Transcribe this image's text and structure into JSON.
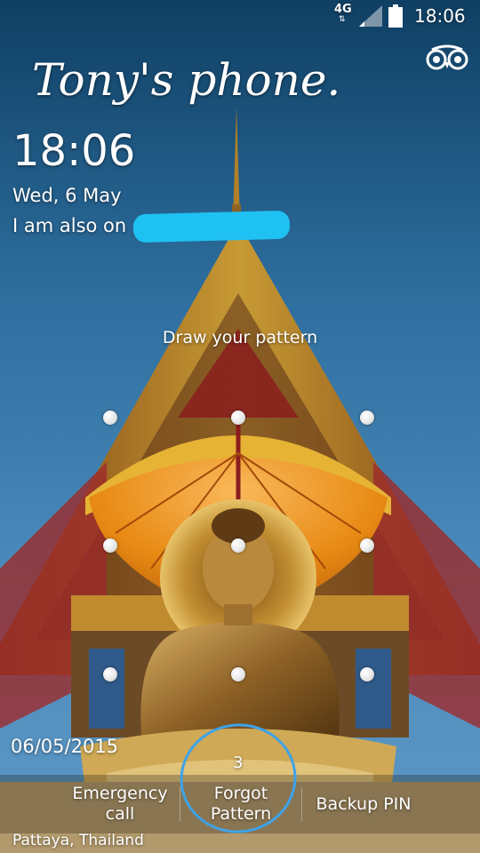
{
  "status_bar": {
    "network_type": "4G",
    "data_arrows": "⇅",
    "signal_icon": "signal-icon",
    "battery_icon": "battery-icon",
    "time": "18:06"
  },
  "app_icon": "tripadvisor-owl-icon",
  "lockscreen": {
    "owner_info": "Tony's phone.",
    "time": "18:06",
    "date": "Wed, 6 May",
    "status_message": "I am also on                      , thanks."
  },
  "pattern": {
    "instruction": "Draw your pattern",
    "dot_color": "#ffffff"
  },
  "wallpaper": {
    "date_stamp": "06/05/2015",
    "location": "Pattaya, Thailand"
  },
  "attempt_count": "3",
  "bottom_bar": {
    "emergency_call": "Emergency\ncall",
    "forgot_pattern": "Forgot\nPattern",
    "backup_pin": "Backup PIN"
  },
  "colors": {
    "sky": "#2f6ea3",
    "redaction": "#1ec1f2",
    "circle_highlight": "#3ea3ea",
    "umbrella": "#e88a14",
    "gold": "#c79a34"
  }
}
